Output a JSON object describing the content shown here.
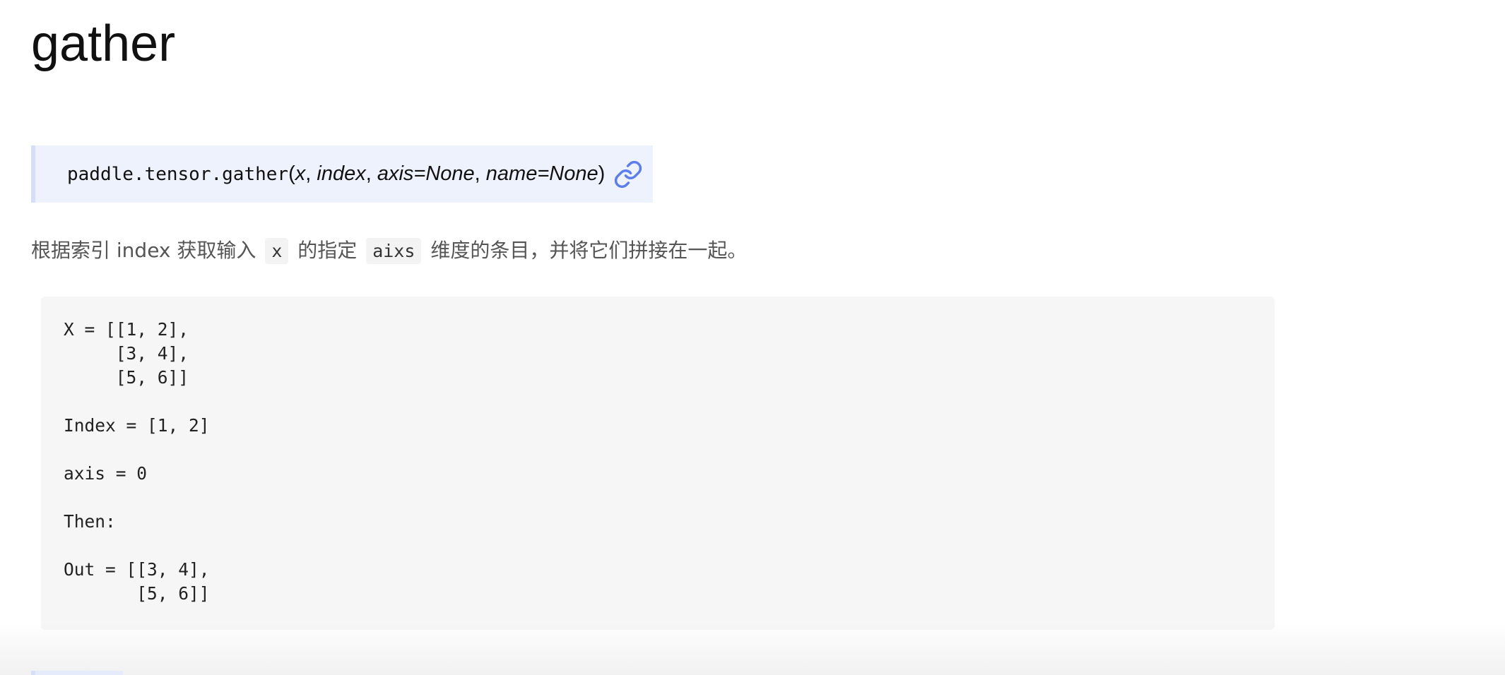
{
  "page": {
    "title": "gather"
  },
  "signature": {
    "module": "paddle.tensor.",
    "function": "gather",
    "open_paren": "(",
    "params": [
      "x",
      "index",
      "axis=None",
      "name=None"
    ],
    "separator": ", ",
    "close_paren": ")",
    "link_icon": "link-icon"
  },
  "description": {
    "part1": "根据索引 index 获取输入",
    "code1": "x",
    "part2": "的指定",
    "code2": "aixs",
    "part3": "维度的条目，并将它们拼接在一起。"
  },
  "example": {
    "code": "X = [[1, 2],\n     [3, 4],\n     [5, 6]]\n\nIndex = [1, 2]\n\naxis = 0\n\nThen:\n\nOut = [[3, 4],\n       [5, 6]]"
  },
  "colors": {
    "link_icon": "#5b7df0",
    "signature_bg": "#eef2fc",
    "code_bg": "#f6f6f6"
  }
}
